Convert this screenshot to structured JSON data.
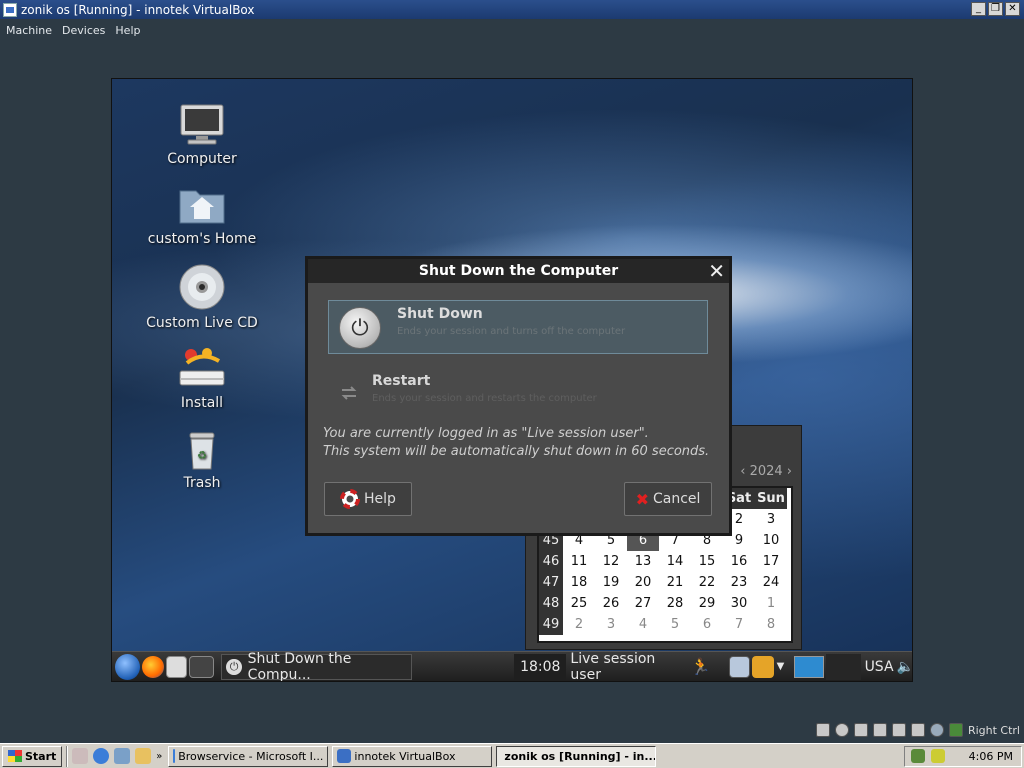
{
  "host": {
    "title": "zonik os [Running] - innotek VirtualBox",
    "menu": [
      "Machine",
      "Devices",
      "Help"
    ],
    "status_text": "Right Ctrl"
  },
  "desktop": {
    "icons": [
      {
        "label": "Computer",
        "icon": "computer-icon"
      },
      {
        "label": "custom's Home",
        "icon": "home-folder-icon"
      },
      {
        "label": "Custom Live CD",
        "icon": "cd-icon"
      },
      {
        "label": "Install",
        "icon": "install-icon"
      },
      {
        "label": "Trash",
        "icon": "trash-icon"
      }
    ]
  },
  "dialog": {
    "title": "Shut Down the Computer",
    "shutdown": {
      "title": "Shut Down",
      "desc": "Ends your session and turns off the computer"
    },
    "restart": {
      "title": "Restart",
      "desc": "Ends your session and restarts the computer"
    },
    "message_line1": "You are currently logged in as \"Live session user\".",
    "message_line2": "This system will be automatically shut down in 60 seconds.",
    "help_label": "Help",
    "cancel_label": "Cancel"
  },
  "calendar": {
    "year": "2024",
    "header_visible": [
      "Sat",
      "Sun"
    ],
    "partial_row": [
      "2",
      "3"
    ],
    "rows": [
      {
        "week": "45",
        "days": [
          "4",
          "5",
          "6",
          "7",
          "8",
          "9",
          "10"
        ]
      },
      {
        "week": "46",
        "days": [
          "11",
          "12",
          "13",
          "14",
          "15",
          "16",
          "17"
        ]
      },
      {
        "week": "47",
        "days": [
          "18",
          "19",
          "20",
          "21",
          "22",
          "23",
          "24"
        ]
      },
      {
        "week": "48",
        "days": [
          "25",
          "26",
          "27",
          "28",
          "29",
          "30",
          "1"
        ]
      },
      {
        "week": "49",
        "days": [
          "2",
          "3",
          "4",
          "5",
          "6",
          "7",
          "8"
        ]
      }
    ],
    "today": "6"
  },
  "guest_panel": {
    "task_label": "Shut Down the Compu...",
    "time": "18:08",
    "user": "Live session user",
    "keyboard": "USA"
  },
  "win_taskbar": {
    "start": "Start",
    "tasks": [
      "Browservice - Microsoft I...",
      "innotek VirtualBox",
      "zonik os [Running] - in..."
    ],
    "clock": "4:06 PM"
  },
  "colors": {
    "desktop_blue": "#1d3860",
    "dialog_bg": "#4a4a4a",
    "highlight": "#4c5b63"
  }
}
